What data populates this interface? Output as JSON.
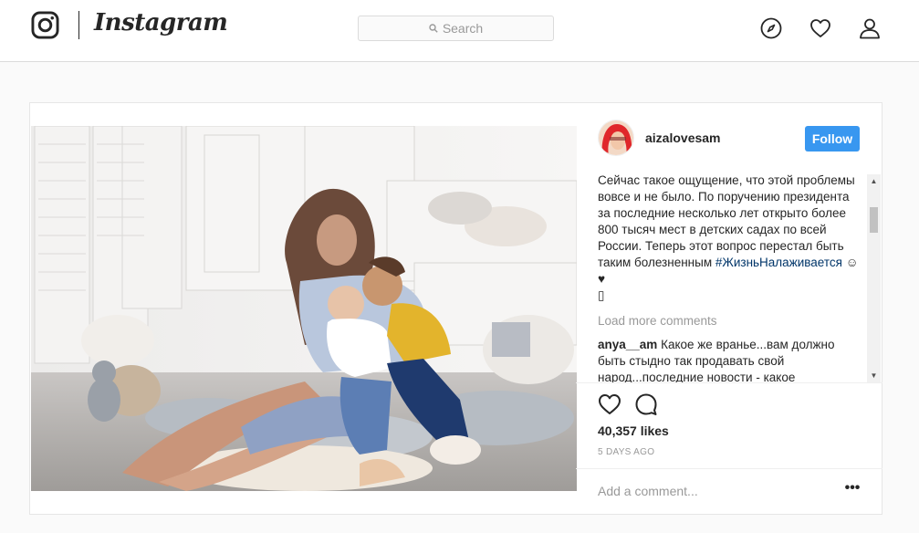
{
  "header": {
    "wordmark": "Instagram",
    "search_placeholder": "Search",
    "icons": [
      "instagram-glyph-icon",
      "search-icon",
      "compass-icon",
      "heart-icon",
      "profile-icon"
    ]
  },
  "post": {
    "username": "aizalovesam",
    "follow_label": "Follow",
    "caption_text": "Сейчас такое ощущение, что этой проблемы вовсе и не было. По поручению президента за последние несколько лет открыто более 800 тысяч мест в детских садах по всей России. Теперь этот вопрос перестал быть таким болезненным ",
    "caption_hashtag": "#ЖизньНалаживается",
    "caption_emoji": " ☺♥",
    "caption_trailing": "▯",
    "load_more": "Load more comments",
    "comments": [
      {
        "user": "anya__am",
        "text": "Какое же вранье...вам должно быть стыдно так продавать свой народ...последние новости - какое"
      }
    ],
    "likes": "40,357 likes",
    "timestamp": "5 DAYS AGO",
    "add_comment_placeholder": "Add a comment...",
    "more_label": "•••"
  },
  "colors": {
    "accent": "#3897f0",
    "hashtag": "#003569",
    "muted": "#999999",
    "border": "#dbdbdb"
  }
}
